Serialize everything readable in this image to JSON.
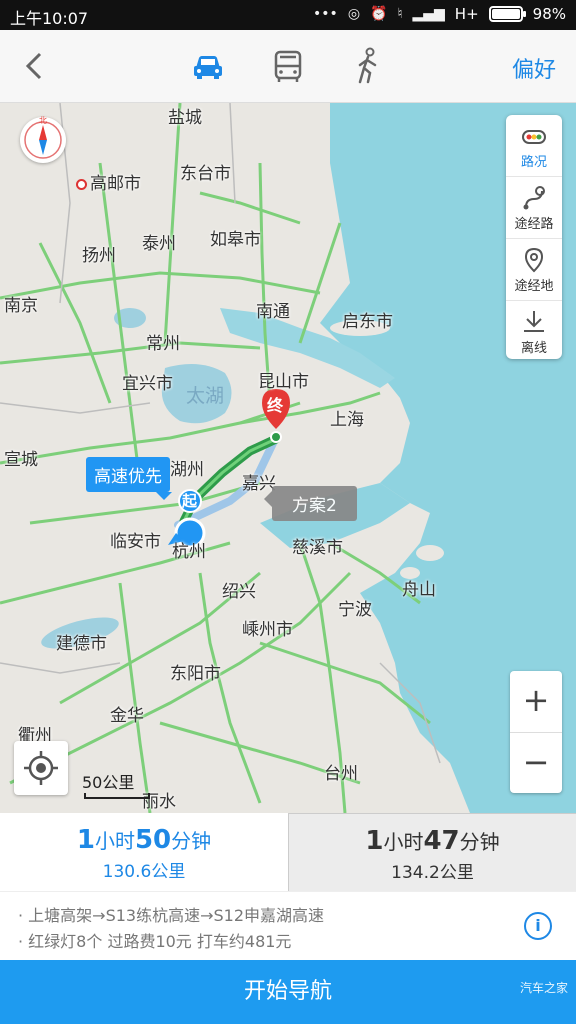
{
  "status": {
    "time": "上午10:07",
    "network": "H+",
    "battery": "98%"
  },
  "topbar": {
    "modes": [
      {
        "icon": "car-icon",
        "active": true
      },
      {
        "icon": "bus-icon",
        "active": false
      },
      {
        "icon": "walk-icon",
        "active": false
      }
    ],
    "preference_label": "偏好"
  },
  "map": {
    "compass_letter": "北",
    "right_panel": [
      {
        "label": "路况",
        "icon": "traffic-light-icon",
        "active": true
      },
      {
        "label": "途经路",
        "icon": "route-via-icon",
        "active": false
      },
      {
        "label": "途经地",
        "icon": "location-pin-icon",
        "active": false
      },
      {
        "label": "离线",
        "icon": "download-icon",
        "active": false
      }
    ],
    "cities": [
      "盐城",
      "高邮市",
      "东台市",
      "扬州",
      "泰州",
      "如皋市",
      "南京",
      "南通",
      "常州",
      "启东市",
      "宜兴市",
      "昆山市",
      "上海",
      "宣城",
      "湖州",
      "嘉兴",
      "临安市",
      "杭州",
      "慈溪市",
      "绍兴",
      "宁波",
      "舟山",
      "建德市",
      "嵊州市",
      "东阳市",
      "金华",
      "衢州",
      "丽水",
      "台州"
    ],
    "lake": "太湖",
    "start_marker": "起",
    "end_marker": "终",
    "route_tag_primary": "高速优先",
    "route_tag_alt": "方案2",
    "scale": "50公里",
    "zoom_in": "+",
    "zoom_out": "−"
  },
  "options": [
    {
      "hours": "1",
      "h_unit": "小时",
      "minutes": "50",
      "m_unit": "分钟",
      "distance": "130.6公里",
      "selected": true
    },
    {
      "hours": "1",
      "h_unit": "小时",
      "minutes": "47",
      "m_unit": "分钟",
      "distance": "134.2公里",
      "selected": false
    }
  ],
  "details": {
    "roads": "· 上塘高架→S13练杭高速→S12申嘉湖高速",
    "summary": "· 红绿灯8个   过路费10元   打车约481元"
  },
  "nav_button": "开始导航",
  "watermark": "汽车之家",
  "colors": {
    "accent": "#1e88e5",
    "route": "#2e9b4a",
    "marker": "#e53935",
    "sea": "#8fd3e0"
  }
}
